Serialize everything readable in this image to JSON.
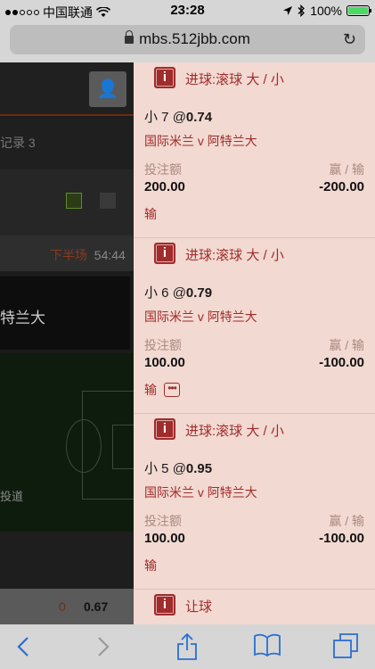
{
  "status_bar": {
    "carrier": "中国联通",
    "time": "23:28",
    "battery": "100%",
    "battery_level": 1.0,
    "icons": [
      "signal-dots-icon",
      "wifi-icon",
      "location-icon",
      "bluetooth-icon",
      "battery-icon"
    ]
  },
  "browser": {
    "url": "mbs.512jbb.com",
    "toolbar_icons": [
      "back-icon",
      "forward-icon",
      "share-icon",
      "bookmarks-icon",
      "tabs-icon"
    ]
  },
  "background_page": {
    "record_label": "记录 3",
    "half_label": "下半场",
    "clock": "54:44",
    "team_partial": "特兰大",
    "pitch_label": "投道",
    "score_zero": "0",
    "odds_value": "0.67"
  },
  "bet_slip": [
    {
      "market": "进球:滚球 大 / 小",
      "selection_prefix": "小 7",
      "at": "@",
      "odds": "0.74",
      "match": "国际米兰 v 阿特兰大",
      "stake_label": "投注额",
      "win_label": "赢 / 输",
      "stake": "200.00",
      "win_loss": "-200.00",
      "result": "输",
      "has_more": false
    },
    {
      "market": "进球:滚球 大 / 小",
      "selection_prefix": "小 6",
      "at": "@",
      "odds": "0.79",
      "match": "国际米兰 v 阿特兰大",
      "stake_label": "投注额",
      "win_label": "赢 / 输",
      "stake": "100.00",
      "win_loss": "-100.00",
      "result": "输",
      "has_more": true
    },
    {
      "market": "进球:滚球 大 / 小",
      "selection_prefix": "小 5",
      "at": "@",
      "odds": "0.95",
      "match": "国际米兰 v 阿特兰大",
      "stake_label": "投注额",
      "win_label": "赢 / 输",
      "stake": "100.00",
      "win_loss": "-100.00",
      "result": "输",
      "has_more": false
    },
    {
      "market": "让球"
    }
  ],
  "colors": {
    "accent": "#a02c2c",
    "panel_bg": "#f2d9d1",
    "ios_blue": "#2a6fd0"
  }
}
